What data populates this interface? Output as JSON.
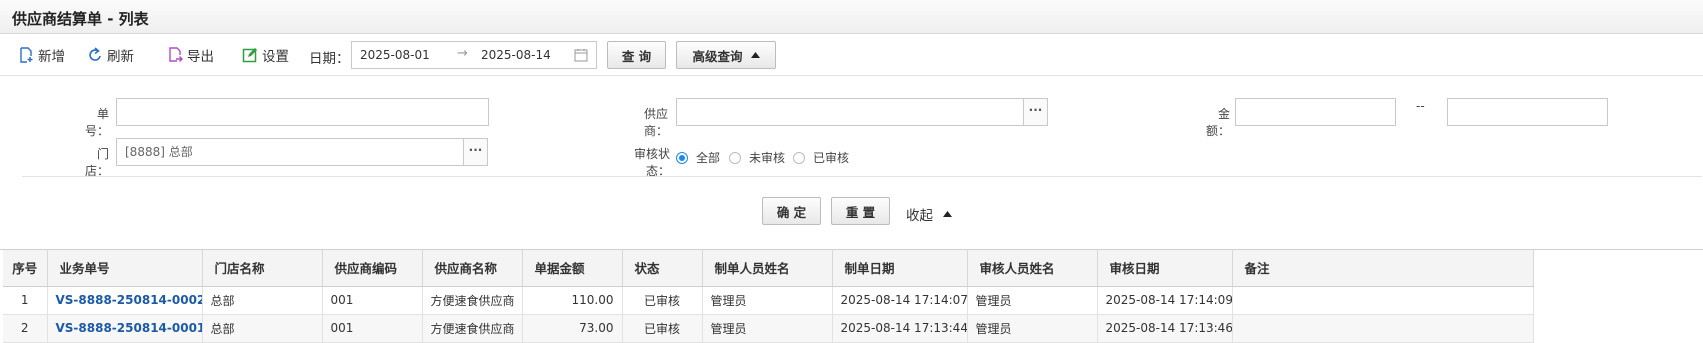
{
  "page": {
    "title": "供应商结算单 - 列表"
  },
  "toolbar": {
    "add_label": "新增",
    "refresh_label": "刷新",
    "export_label": "导出",
    "settings_label": "设置",
    "date_label": "日期：",
    "date_from": "2025-08-01",
    "date_to": "2025-08-14",
    "range_arrow": "→",
    "query_label": "查 询",
    "advanced_label": "高级查询"
  },
  "filters": {
    "doc_no_label": "单号：",
    "doc_no_value": "",
    "supplier_label": "供应商：",
    "supplier_value": "",
    "amount_label": "金额：",
    "amount_min": "",
    "amount_sep": "--",
    "amount_max": "",
    "store_label": "门店：",
    "store_value": "[8888] 总部",
    "dots": "···",
    "audit_label": "审核状态：",
    "audit_options": [
      "全部",
      "未审核",
      "已审核"
    ],
    "audit_selected": "全部",
    "confirm_label": "确 定",
    "reset_label": "重 置",
    "collapse_label": "收起"
  },
  "table": {
    "columns": [
      "序号",
      "业务单号",
      "门店名称",
      "供应商编码",
      "供应商名称",
      "单据金额",
      "状态",
      "制单人员姓名",
      "制单日期",
      "审核人员姓名",
      "审核日期",
      "备注"
    ],
    "rows": [
      [
        "1",
        "VS-8888-250814-0002",
        "总部",
        "001",
        "方便速食供应商",
        "110.00",
        "已审核",
        "管理员",
        "2025-08-14 17:14:07",
        "管理员",
        "2025-08-14 17:14:09",
        ""
      ],
      [
        "2",
        "VS-8888-250814-0001",
        "总部",
        "001",
        "方便速食供应商",
        "73.00",
        "已审核",
        "管理员",
        "2025-08-14 17:13:44",
        "管理员",
        "2025-08-14 17:13:46",
        ""
      ]
    ]
  },
  "colors": {
    "link": "#1a5aa8",
    "radio_active": "#1e88e5",
    "icon_blue": "#2a6fc9",
    "icon_green": "#2e9e3f",
    "icon_purple": "#b04cc8"
  }
}
